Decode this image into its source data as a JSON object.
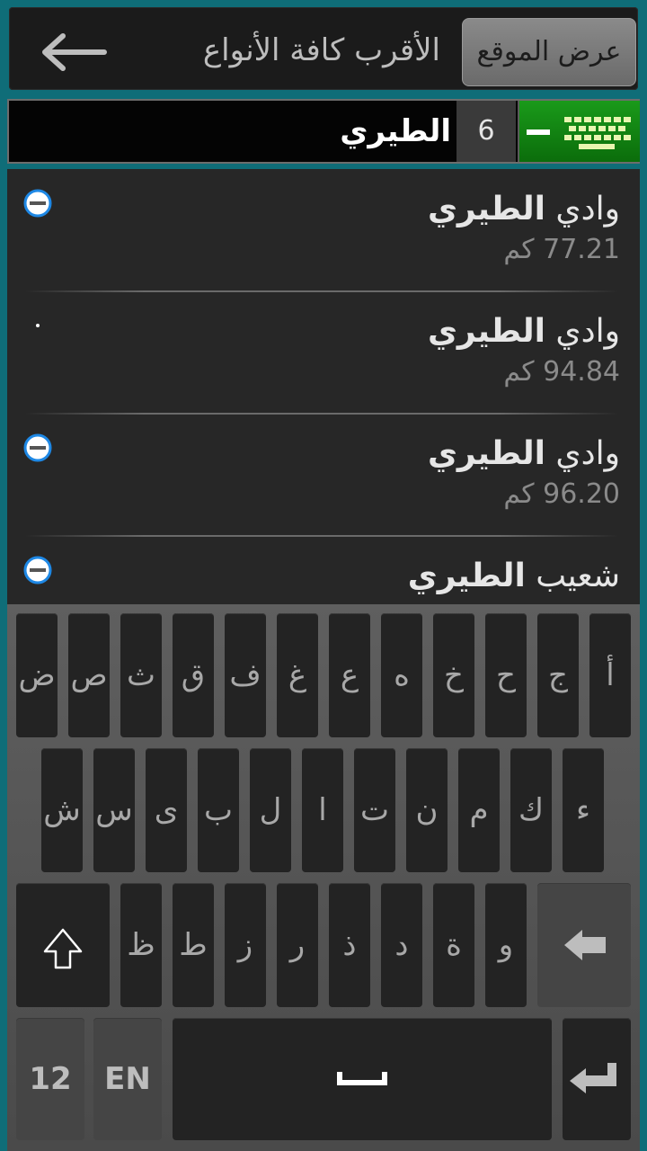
{
  "header": {
    "title": "الأقرب كافة الأنواع",
    "show_location_label": "عرض الموقع"
  },
  "search": {
    "query": "الطيري",
    "result_count": "6"
  },
  "results": [
    {
      "name_prefix": "وادي ",
      "name_match": "الطيري",
      "distance": "77.21 كم"
    },
    {
      "name_prefix": "وادي ",
      "name_match": "الطيري",
      "distance": "94.84 كم"
    },
    {
      "name_prefix": "وادي ",
      "name_match": "الطيري",
      "distance": "96.20 كم"
    },
    {
      "name_prefix": "شعيب ",
      "name_match": "الطيري",
      "distance": ""
    }
  ],
  "keyboard": {
    "row1": [
      "ض",
      "ص",
      "ث",
      "ق",
      "ف",
      "غ",
      "ع",
      "ه",
      "خ",
      "ح",
      "ج",
      "أ"
    ],
    "row2": [
      "ش",
      "س",
      "ى",
      "ب",
      "ل",
      "ا",
      "ت",
      "ن",
      "م",
      "ك",
      "ء"
    ],
    "row3": [
      "ظ",
      "ط",
      "ز",
      "ر",
      "ذ",
      "د",
      "ة",
      "و"
    ],
    "numbers_label": "12",
    "lang_label": "EN",
    "space_label": "ـــ"
  },
  "colors": {
    "accent_green": "#0b8a0b",
    "direction_icon_blue": "#1e88e5"
  }
}
